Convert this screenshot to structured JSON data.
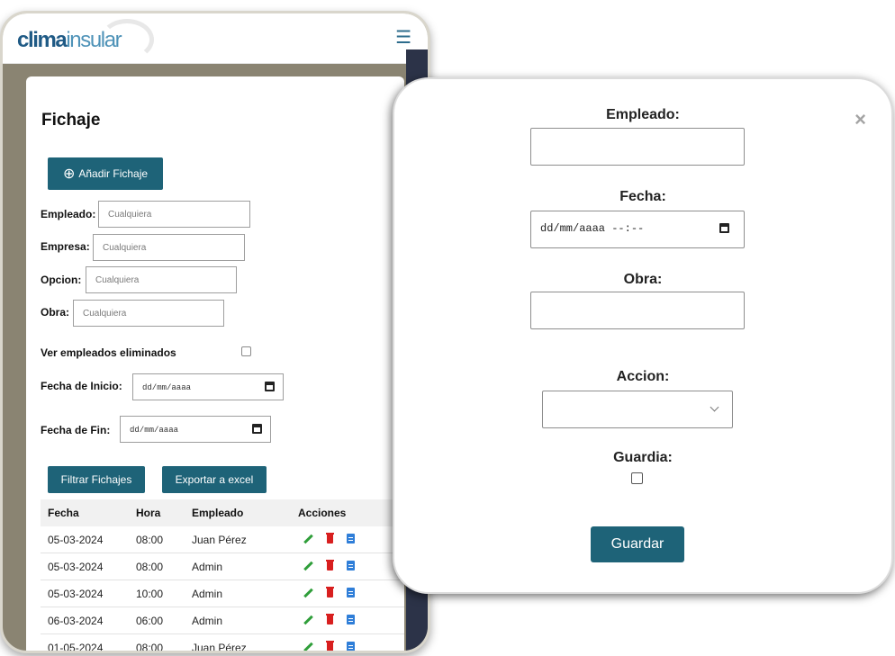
{
  "app": {
    "logo_part1": "clima",
    "logo_part2": "insular",
    "menu_icon": "hamburger-icon"
  },
  "page": {
    "title": "Fichaje",
    "add_button_label": "Añadir Fichaje",
    "add_button_icon": "plus-circle-icon"
  },
  "filters": {
    "empleado_label": "Empleado:",
    "empleado_placeholder": "Cualquiera",
    "empresa_label": "Empresa:",
    "empresa_placeholder": "Cualquiera",
    "opcion_label": "Opcion:",
    "opcion_placeholder": "Cualquiera",
    "obra_label": "Obra:",
    "obra_placeholder": "Cualquiera",
    "ver_eliminados_label": "Ver empleados eliminados",
    "fecha_inicio_label": "Fecha de Inicio:",
    "fecha_inicio_value": "dd/mm/aaaa",
    "fecha_fin_label": "Fecha de Fin:",
    "fecha_fin_value": "dd/mm/aaaa",
    "filter_button": "Filtrar Fichajes",
    "export_button": "Exportar a excel"
  },
  "table": {
    "headers": [
      "Fecha",
      "Hora",
      "Empleado",
      "Acciones"
    ],
    "rows": [
      {
        "fecha": "05-03-2024",
        "hora": "08:00",
        "empleado": "Juan Pérez"
      },
      {
        "fecha": "05-03-2024",
        "hora": "08:00",
        "empleado": "Admin"
      },
      {
        "fecha": "05-03-2024",
        "hora": "10:00",
        "empleado": "Admin"
      },
      {
        "fecha": "06-03-2024",
        "hora": "06:00",
        "empleado": "Admin"
      },
      {
        "fecha": "01-05-2024",
        "hora": "08:00",
        "empleado": "Juan Pérez"
      }
    ],
    "action_icons": [
      "edit-icon",
      "trash-icon",
      "document-icon"
    ]
  },
  "modal": {
    "close_symbol": "×",
    "empleado_label": "Empleado:",
    "empleado_value": "",
    "fecha_label": "Fecha:",
    "fecha_value": "dd/mm/aaaa --:--",
    "obra_label": "Obra:",
    "obra_value": "",
    "accion_label": "Accion:",
    "accion_value": "",
    "guardia_label": "Guardia:",
    "save_button": "Guardar"
  },
  "colors": {
    "primary_button": "#1e6378",
    "edit_icon": "#2f9e3a",
    "delete_icon": "#d81f1f",
    "doc_icon": "#2f7ed8"
  }
}
